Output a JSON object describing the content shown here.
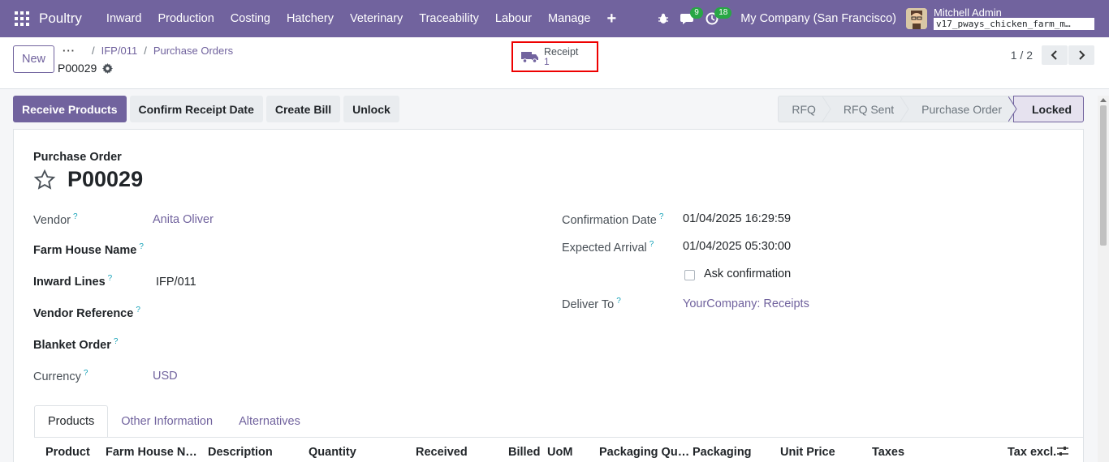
{
  "navbar": {
    "brand": "Poultry",
    "menu": [
      "Inward",
      "Production",
      "Costing",
      "Hatchery",
      "Veterinary",
      "Traceability",
      "Labour",
      "Manage"
    ],
    "plus": "+",
    "chat_count": "9",
    "activity_count": "18",
    "company": "My Company (San Francisco)",
    "user_name": "Mitchell Admin",
    "db_name": "v17_pways_chicken_farm_m…"
  },
  "control": {
    "new_label": "New",
    "breadcrumb": [
      "IFP/011",
      "Purchase Orders"
    ],
    "current": "P00029",
    "smart_button": {
      "label": "Receipt",
      "value": "1"
    },
    "pager": "1 / 2"
  },
  "actions": [
    "Receive Products",
    "Confirm Receipt Date",
    "Create Bill",
    "Unlock"
  ],
  "statusbar": [
    "RFQ",
    "RFQ Sent",
    "Purchase Order",
    "Locked"
  ],
  "form": {
    "doc_type": "Purchase Order",
    "name": "P00029",
    "left": [
      {
        "label": "Vendor",
        "value": "Anita Oliver"
      },
      {
        "label": "Farm House Name",
        "value": ""
      },
      {
        "label": "Inward Lines",
        "value": "IFP/011"
      },
      {
        "label": "Vendor Reference",
        "value": ""
      },
      {
        "label": "Blanket Order",
        "value": ""
      },
      {
        "label": "Currency",
        "value": "USD"
      }
    ],
    "right": [
      {
        "label": "Confirmation Date",
        "value": "01/04/2025 16:29:59"
      },
      {
        "label": "Expected Arrival",
        "value": "01/04/2025 05:30:00"
      },
      {
        "label": "",
        "value": "Ask confirmation"
      },
      {
        "label": "Deliver To",
        "value": "YourCompany: Receipts"
      }
    ],
    "help_mark": "?"
  },
  "tabs": [
    "Products",
    "Other Information",
    "Alternatives"
  ],
  "table_headers": [
    "Product",
    "Farm House N…",
    "Description",
    "Quantity",
    "Received",
    "Billed",
    "UoM",
    "Packaging Qu…",
    "Packaging",
    "Unit Price",
    "Taxes",
    "Tax excl."
  ],
  "colors": {
    "brand": "#71639e",
    "badge": "#28a745",
    "highlight": "#ee0000"
  }
}
